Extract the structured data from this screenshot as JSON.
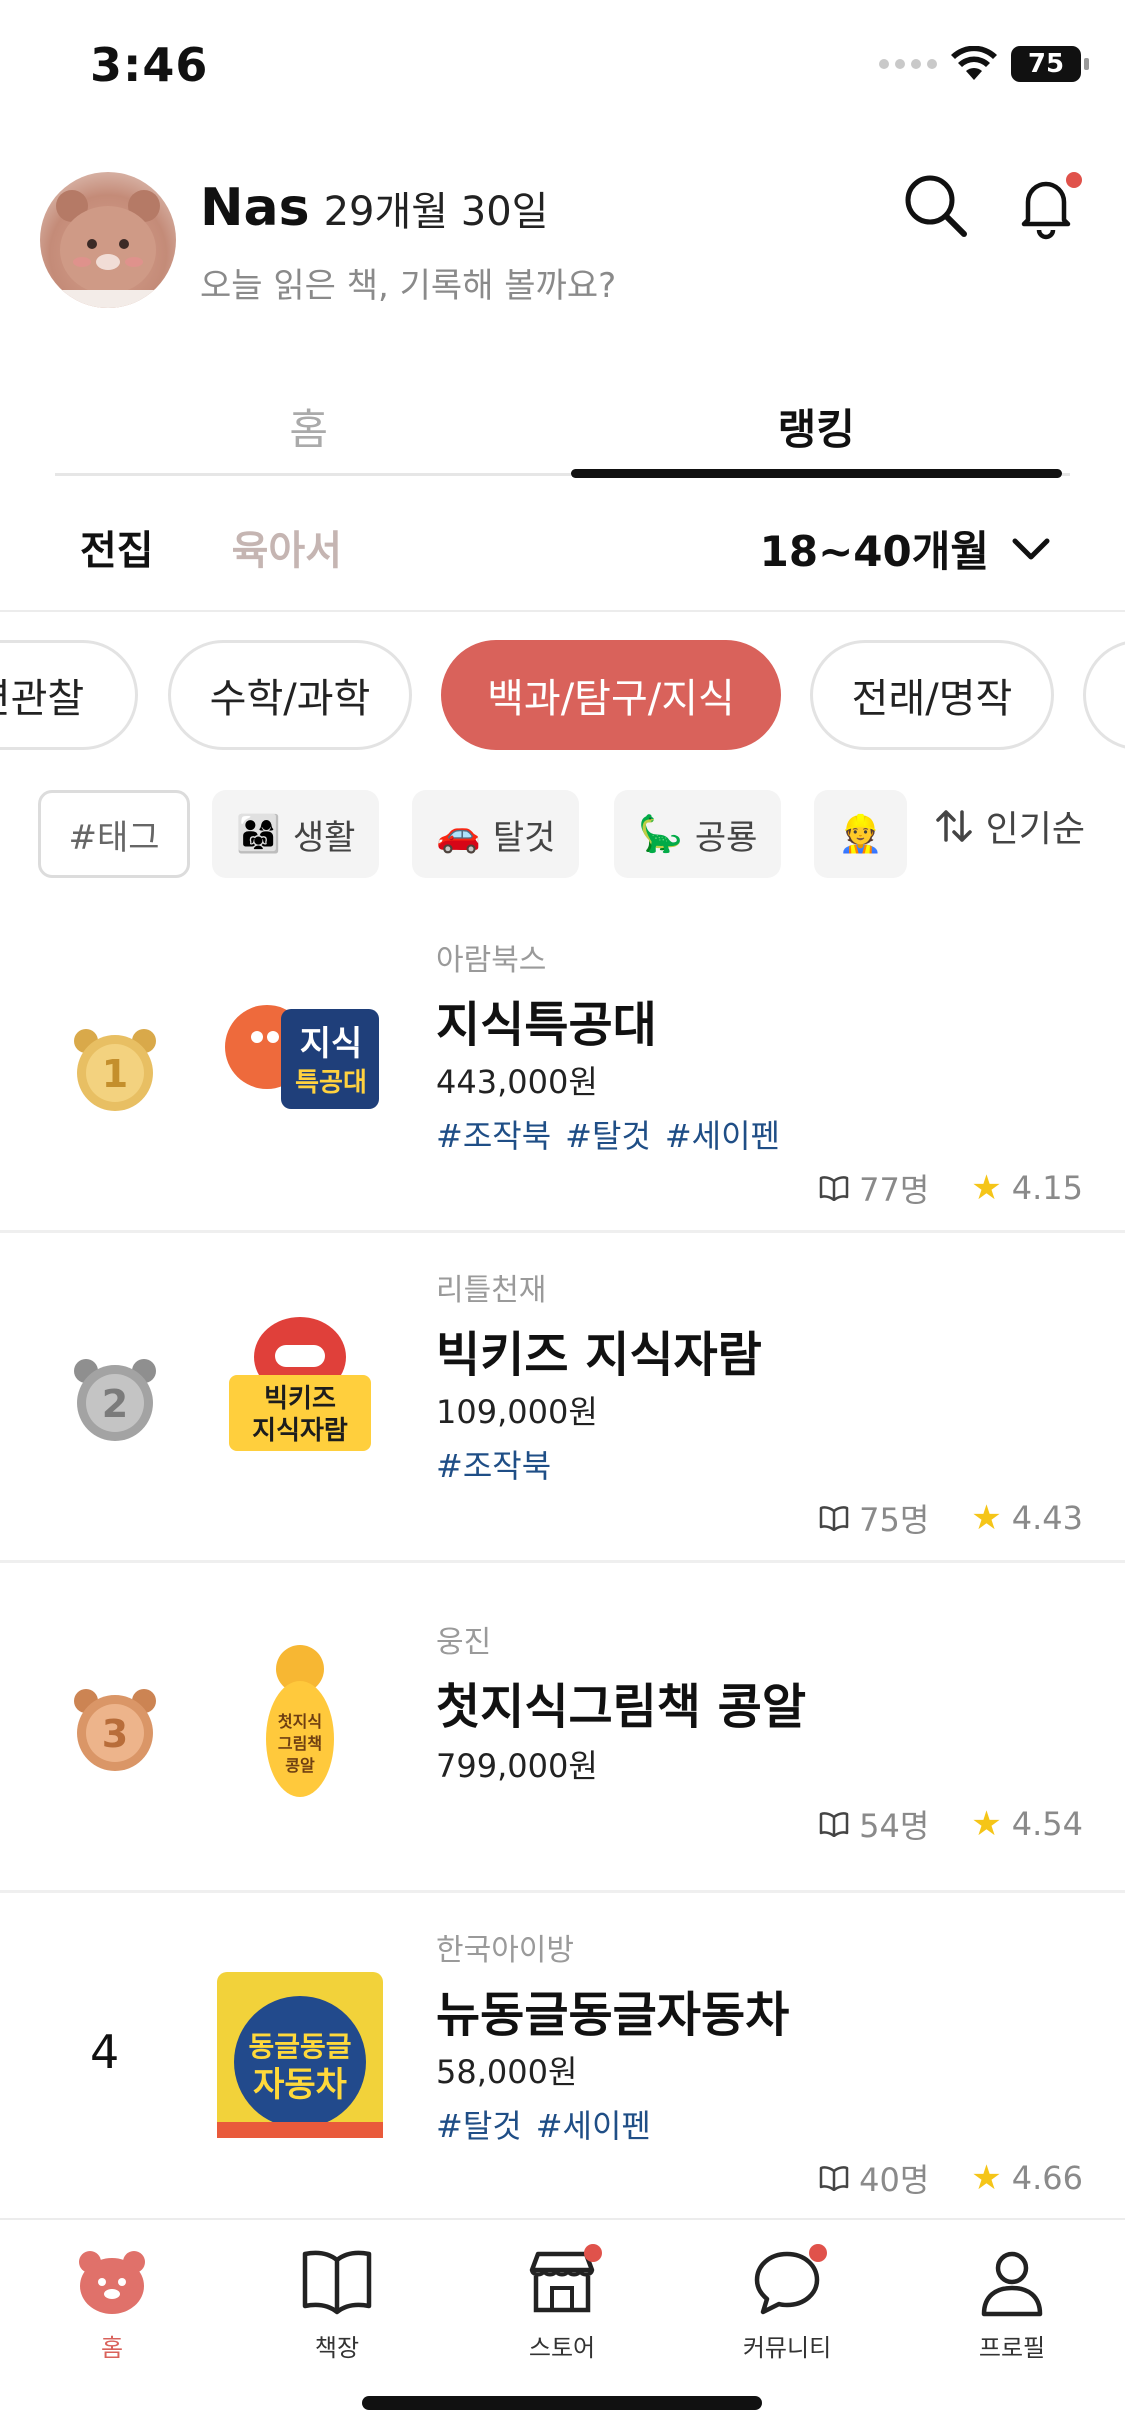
{
  "status_bar": {
    "time": "3:46",
    "battery": "75"
  },
  "profile": {
    "name": "Nas",
    "age": "29개월 30일",
    "subtitle": "오늘 읽은 책, 기록해 볼까요?"
  },
  "main_tabs": [
    {
      "label": "홈",
      "active": false
    },
    {
      "label": "랭킹",
      "active": true
    }
  ],
  "sub_tabs": [
    {
      "label": "전집",
      "active": true
    },
    {
      "label": "육아서",
      "active": false
    }
  ],
  "age_filter": {
    "label": "18~40개월"
  },
  "categories": [
    {
      "label": "연관찰",
      "active": false
    },
    {
      "label": "수학/과학",
      "active": false
    },
    {
      "label": "백과/탐구/지식",
      "active": true
    },
    {
      "label": "전래/명작",
      "active": false
    }
  ],
  "tag_filter": {
    "placeholder": "#태그",
    "chips": [
      {
        "emoji": "👨‍👩‍👧",
        "label": "생활"
      },
      {
        "emoji": "🚗",
        "label": "탈것"
      },
      {
        "emoji": "🦕",
        "label": "공룡"
      },
      {
        "emoji": "👷",
        "label": ""
      }
    ]
  },
  "sort": {
    "label": "인기순"
  },
  "ranking": [
    {
      "rank": "1",
      "publisher": "아람북스",
      "title": "지식특공대",
      "price": "443,000원",
      "tags": [
        "#조작북",
        "#탈것",
        "#세이펜"
      ],
      "readers": "77명",
      "rating": "4.15"
    },
    {
      "rank": "2",
      "publisher": "리틀천재",
      "title": "빅키즈 지식자람",
      "price": "109,000원",
      "tags": [
        "#조작북"
      ],
      "readers": "75명",
      "rating": "4.43"
    },
    {
      "rank": "3",
      "publisher": "웅진",
      "title": "첫지식그림책 콩알",
      "price": "799,000원",
      "tags": [],
      "readers": "54명",
      "rating": "4.54"
    },
    {
      "rank": "4",
      "publisher": "한국아이방",
      "title": "뉴동글동글자동차",
      "price": "58,000원",
      "tags": [
        "#탈것",
        "#세이펜"
      ],
      "readers": "40명",
      "rating": "4.66"
    }
  ],
  "book_logos": {
    "b1": [
      "지식",
      "특공대"
    ],
    "b2": [
      "빅키즈",
      "지식자람"
    ],
    "b3": [
      "첫지식",
      "그림책",
      "콩알"
    ],
    "b4": [
      "동글동글",
      "자동차"
    ]
  },
  "bottom_nav": [
    {
      "label": "홈",
      "icon": "bear-home-icon",
      "active": true
    },
    {
      "label": "책장",
      "icon": "book-icon",
      "active": false
    },
    {
      "label": "스토어",
      "icon": "store-icon",
      "active": false
    },
    {
      "label": "커뮤니티",
      "icon": "chat-icon",
      "active": false
    },
    {
      "label": "프로필",
      "icon": "person-icon",
      "active": false
    }
  ],
  "colors": {
    "accent": "#d9625b",
    "tag_text": "#1f4e86",
    "star": "#f5c518",
    "notification": "#e0524b"
  }
}
